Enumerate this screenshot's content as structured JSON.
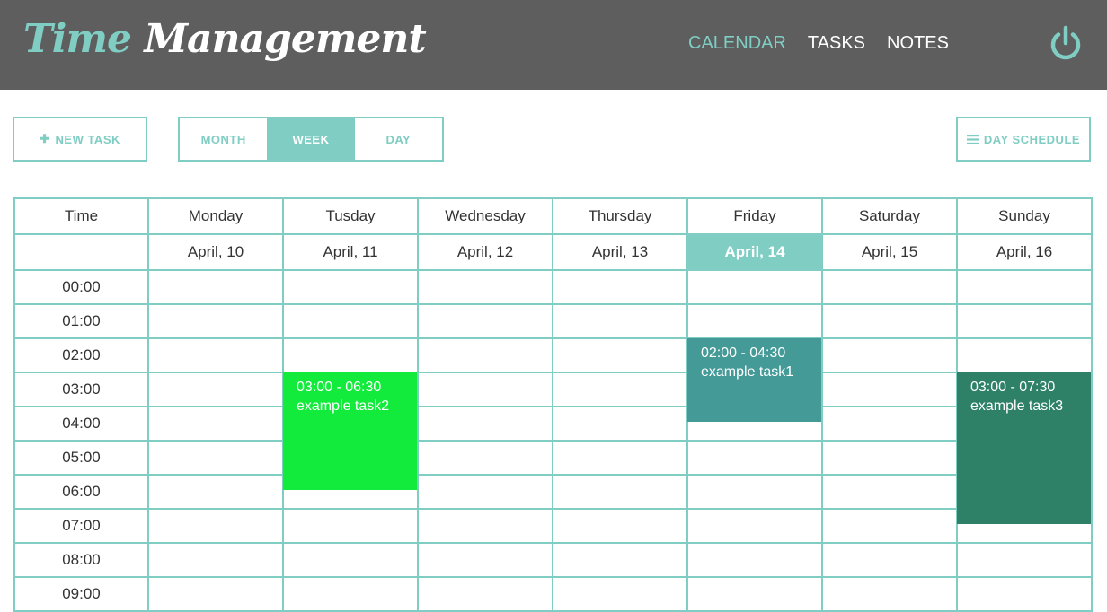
{
  "header": {
    "brand_word1": "Time",
    "brand_word2": "Management",
    "nav": [
      {
        "label": "CALENDAR",
        "active": true
      },
      {
        "label": "TASKS",
        "active": false
      },
      {
        "label": "NOTES",
        "active": false
      }
    ],
    "power_icon": "power-icon"
  },
  "toolbar": {
    "new_task_label": "NEW TASK",
    "new_task_icon": "plus-icon",
    "views": [
      {
        "label": "MONTH",
        "active": false
      },
      {
        "label": "WEEK",
        "active": true
      },
      {
        "label": "DAY",
        "active": false
      }
    ],
    "day_schedule_label": "DAY SCHEDULE",
    "day_schedule_icon": "list-icon"
  },
  "calendar": {
    "time_header": "Time",
    "days": [
      {
        "name": "Monday",
        "date": "April, 10"
      },
      {
        "name": "Tusday",
        "date": "April, 11"
      },
      {
        "name": "Wednesday",
        "date": "April, 12"
      },
      {
        "name": "Thursday",
        "date": "April, 13"
      },
      {
        "name": "Friday",
        "date": "April, 14",
        "today": true
      },
      {
        "name": "Saturday",
        "date": "April, 15"
      },
      {
        "name": "Sunday",
        "date": "April, 16"
      }
    ],
    "hours": [
      "00:00",
      "01:00",
      "02:00",
      "03:00",
      "04:00",
      "05:00",
      "06:00",
      "07:00",
      "08:00",
      "09:00"
    ],
    "events": [
      {
        "day": 1,
        "start": 3.0,
        "end": 6.5,
        "time": "03:00 - 06:30",
        "title": "example task2",
        "color": "#12eb3b"
      },
      {
        "day": 4,
        "start": 2.0,
        "end": 4.5,
        "time": "02:00 - 04:30",
        "title": "example task1",
        "color": "#439a97"
      },
      {
        "day": 6,
        "start": 3.0,
        "end": 7.5,
        "time": "03:00 - 07:30",
        "title": "example task3",
        "color": "#2e8166"
      }
    ]
  },
  "colors": {
    "accent": "#7fcdc3",
    "header_bg": "#5e5e5e"
  }
}
